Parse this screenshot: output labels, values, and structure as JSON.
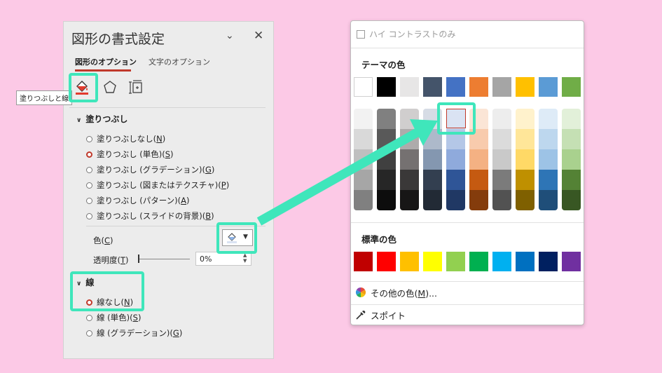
{
  "pane": {
    "title": "図形の書式設定",
    "collapse_icon": "chevron-down-icon",
    "close_icon": "close-icon",
    "tabs": [
      {
        "label": "図形のオプション",
        "active": true
      },
      {
        "label": "文字のオプション",
        "active": false
      }
    ],
    "category_icons": [
      "paint-bucket-icon",
      "pentagon-icon",
      "size-layout-icon"
    ],
    "tooltip": "塗りつぶしと線",
    "fill": {
      "heading": "塗りつぶし",
      "options": [
        {
          "text": "塗りつぶしなし(",
          "key": "N",
          "end": ")",
          "selected": false
        },
        {
          "text": "塗りつぶし (単色)(",
          "key": "S",
          "end": ")",
          "selected": true
        },
        {
          "text": "塗りつぶし (グラデーション)(",
          "key": "G",
          "end": ")",
          "selected": false
        },
        {
          "text": "塗りつぶし (図またはテクスチャ)(",
          "key": "P",
          "end": ")",
          "selected": false
        },
        {
          "text": "塗りつぶし (パターン)(",
          "key": "A",
          "end": ")",
          "selected": false
        },
        {
          "text": "塗りつぶし (スライドの背景)(",
          "key": "B",
          "end": ")",
          "selected": false
        }
      ],
      "color_label": {
        "text": "色(",
        "key": "C",
        "end": ")"
      },
      "transparency_label": {
        "text": "透明度(",
        "key": "T",
        "end": ")"
      },
      "transparency_value": "0%"
    },
    "line": {
      "heading": "線",
      "options": [
        {
          "text": "線なし(",
          "key": "N",
          "end": ")",
          "selected": true
        },
        {
          "text": "線 (単色)(",
          "key": "S",
          "end": ")",
          "selected": false
        },
        {
          "text": "線 (グラデーション)(",
          "key": "G",
          "end": ")",
          "selected": false
        }
      ]
    }
  },
  "palette": {
    "high_contrast": "ハイ コントラストのみ",
    "theme_heading": "テーマの色",
    "theme_base": [
      "#ffffff",
      "#000000",
      "#e7e6e6",
      "#44546a",
      "#4472c4",
      "#ed7d31",
      "#a5a5a5",
      "#ffc000",
      "#5b9bd5",
      "#70ad47"
    ],
    "theme_shades": [
      [
        "#f2f2f2",
        "#d9d9d9",
        "#bfbfbf",
        "#a6a6a6",
        "#808080"
      ],
      [
        "#808080",
        "#595959",
        "#404040",
        "#262626",
        "#0d0d0d"
      ],
      [
        "#d0cece",
        "#aeabab",
        "#757171",
        "#3a3838",
        "#171616"
      ],
      [
        "#d6dce5",
        "#adb9ca",
        "#8497b0",
        "#333f50",
        "#222a35"
      ],
      [
        "#dae3f3",
        "#b4c7e7",
        "#8faadc",
        "#2f5597",
        "#203864"
      ],
      [
        "#fbe5d6",
        "#f8cbad",
        "#f4b183",
        "#c55a11",
        "#843c0c"
      ],
      [
        "#ededed",
        "#dbdbdb",
        "#c9c9c9",
        "#7b7b7b",
        "#525252"
      ],
      [
        "#fff2cc",
        "#ffe699",
        "#ffd966",
        "#bf9000",
        "#7f6000"
      ],
      [
        "#deebf7",
        "#bdd7ee",
        "#9dc3e6",
        "#2e75b6",
        "#1f4e79"
      ],
      [
        "#e2f0d9",
        "#c5e0b4",
        "#a9d18e",
        "#548235",
        "#385723"
      ]
    ],
    "selected_swatch": {
      "column": 4,
      "row": 0
    },
    "standard_heading": "標準の色",
    "standard": [
      "#c00000",
      "#ff0000",
      "#ffc000",
      "#ffff00",
      "#92d050",
      "#00b050",
      "#00b0f0",
      "#0070c0",
      "#002060",
      "#7030a0"
    ],
    "more_colors": {
      "text": "その他の色(",
      "key": "M",
      "end": ")..."
    },
    "more_colors_icon": "color-wheel-icon",
    "eyedropper": "スポイト",
    "eyedropper_icon": "eyedropper-icon"
  },
  "annotation": {
    "highlight_color": "#3fe6bb",
    "arrow_color": "#3fe6bb"
  }
}
